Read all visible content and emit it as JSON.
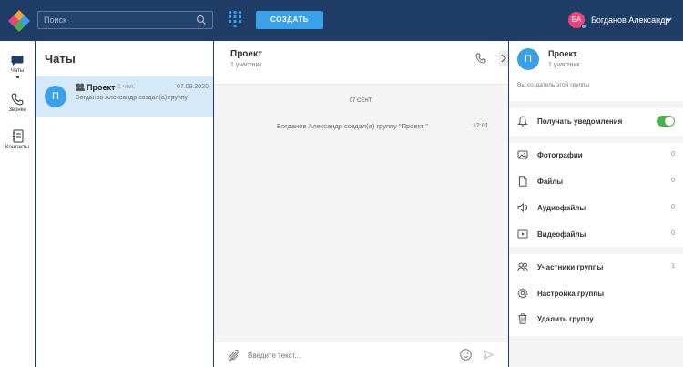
{
  "header": {
    "search_placeholder": "Поиск",
    "create_label": "СОЗДАТЬ",
    "user_initials": "БА",
    "user_name": "Богданов Александр"
  },
  "nav": {
    "items": [
      {
        "label": "Чаты"
      },
      {
        "label": "Звонки"
      },
      {
        "label": "Контакты"
      }
    ]
  },
  "chatlist": {
    "title": "Чаты",
    "chats": [
      {
        "initial": "П",
        "name": "Проект",
        "members": "1 чел.",
        "date": "07.09.2020",
        "last_message": "Богданов Александр создал(а) группу"
      }
    ]
  },
  "conversation": {
    "title": "Проект",
    "subtitle": "1 участник",
    "day_separator": "07 СЕНТ.",
    "messages": [
      {
        "text": "Богданов Александр создал(а) группу \"Проект \"",
        "time": "12:01"
      }
    ],
    "composer_placeholder": "Введите текст..."
  },
  "details": {
    "initial": "П",
    "title": "Проект",
    "subtitle": "1 участник",
    "note": "Вы создатель этой группы",
    "notifications_label": "Получать уведомления",
    "notifications_on": true,
    "media": [
      {
        "label": "Фотографии",
        "count": "0",
        "icon": "photo-icon"
      },
      {
        "label": "Файлы",
        "count": "0",
        "icon": "file-icon"
      },
      {
        "label": "Аудиофайлы",
        "count": "0",
        "icon": "audio-icon"
      },
      {
        "label": "Видеофайлы",
        "count": "0",
        "icon": "video-icon"
      }
    ],
    "actions": [
      {
        "label": "Участники группы",
        "count": "1",
        "icon": "members-icon"
      },
      {
        "label": "Настройка группы",
        "count": "",
        "icon": "settings-icon"
      },
      {
        "label": "Удалить группу",
        "count": "",
        "icon": "trash-icon"
      }
    ]
  },
  "colors": {
    "header_bg": "#1f3d66",
    "accent": "#3aa0e8",
    "avatar_user": "#e8457a",
    "selected_row": "#d6e9f8",
    "toggle_on": "#4caf50"
  }
}
